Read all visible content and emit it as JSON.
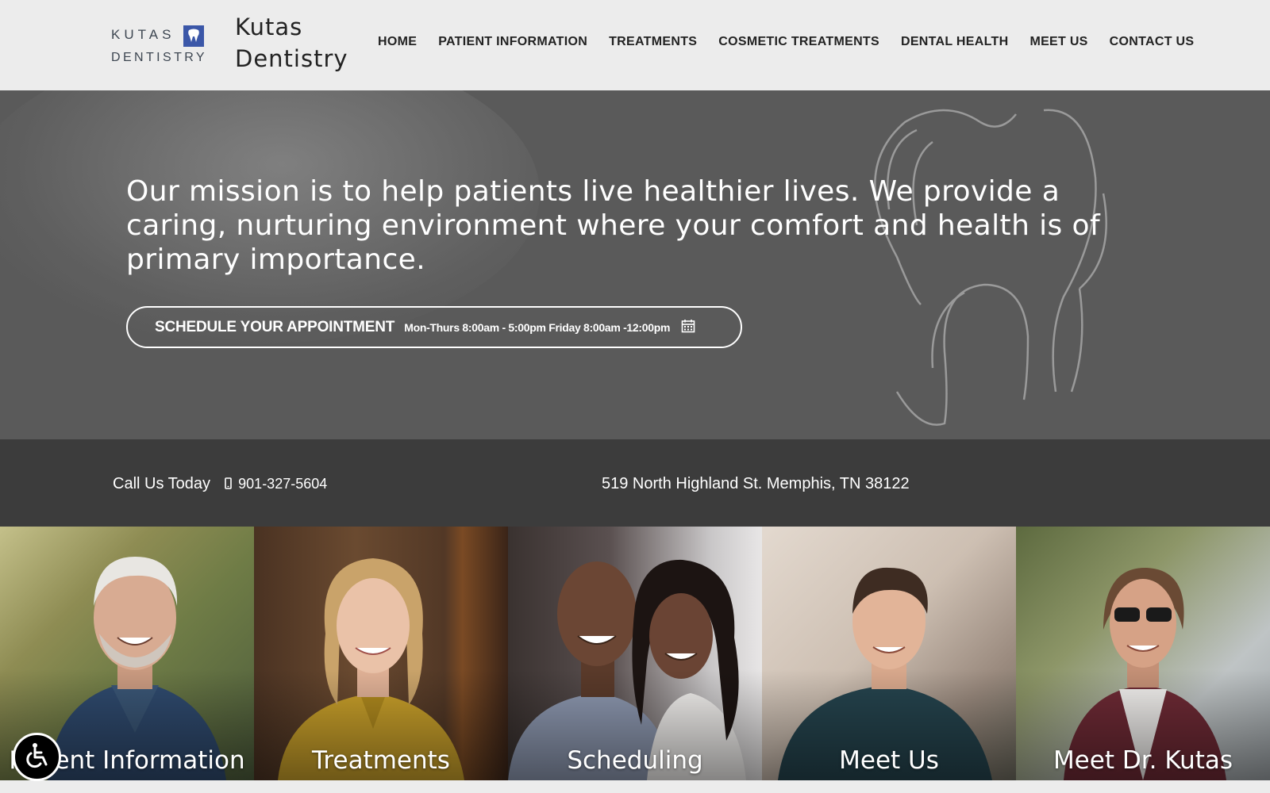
{
  "header": {
    "logo_top": "KUTAS",
    "logo_bottom": "DENTISTRY",
    "site_name": "Kutas Dentistry",
    "nav": [
      {
        "label": "HOME"
      },
      {
        "label": "PATIENT INFORMATION"
      },
      {
        "label": "TREATMENTS"
      },
      {
        "label": "COSMETIC TREATMENTS"
      },
      {
        "label": "DENTAL HEALTH"
      },
      {
        "label": "MEET US"
      },
      {
        "label": "CONTACT US"
      }
    ]
  },
  "hero": {
    "mission": "Our mission is to help patients live healthier lives. We provide a caring, nurturing environment where your comfort and health is of primary importance.",
    "appointment_label": "SCHEDULE YOUR APPOINTMENT",
    "appointment_hours": "Mon-Thurs 8:00am - 5:00pm Friday 8:00am -12:00pm",
    "calendar_icon": "calendar-icon"
  },
  "info": {
    "call_label": "Call Us Today",
    "phone": "901-327-5604",
    "address": "519 North Highland St. Memphis, TN 38122"
  },
  "tiles": [
    {
      "label": "Patient Information"
    },
    {
      "label": "Treatments"
    },
    {
      "label": "Scheduling"
    },
    {
      "label": "Meet Us"
    },
    {
      "label": "Meet Dr. Kutas"
    }
  ],
  "colors": {
    "brand_blue": "#3b57a8",
    "header_bg": "#ececec",
    "hero_bg": "#5a5a5a",
    "infobar_bg": "#3c3c3c"
  },
  "accessibility_icon": "wheelchair-icon"
}
